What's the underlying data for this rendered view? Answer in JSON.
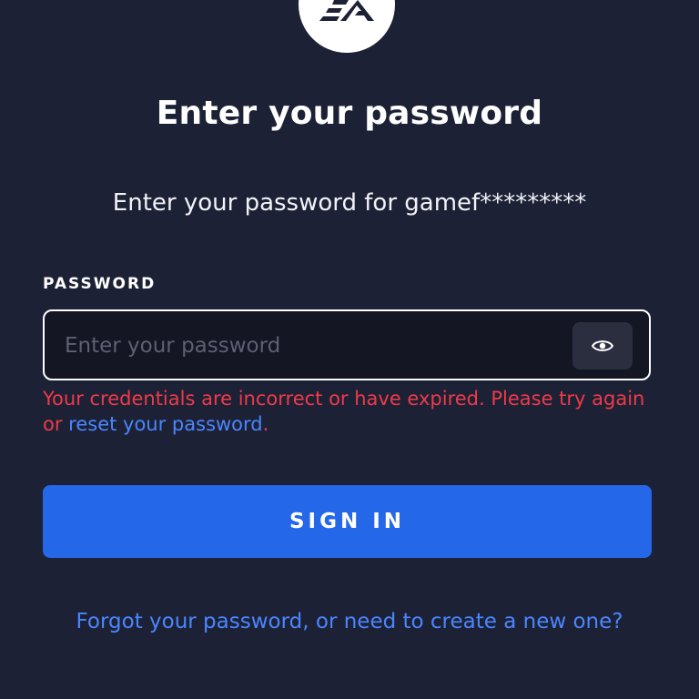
{
  "logo": {
    "icon": "ea-logo-icon"
  },
  "title": "Enter your password",
  "subtitle": "Enter your password for gamef*********",
  "password_field": {
    "label": "PASSWORD",
    "placeholder": "Enter your password",
    "value": "",
    "toggle_icon": "eye-icon"
  },
  "error": {
    "text_before": "Your credentials are incorrect or have expired. Please try again or ",
    "link_text": "reset your password",
    "text_after": "."
  },
  "sign_in_label": "SIGN IN",
  "forgot_link": "Forgot your password, or need to create a new one?",
  "colors": {
    "background": "#1d2135",
    "primary_button": "#2467e8",
    "link": "#4a86ff",
    "error": "#ef3a4a"
  }
}
